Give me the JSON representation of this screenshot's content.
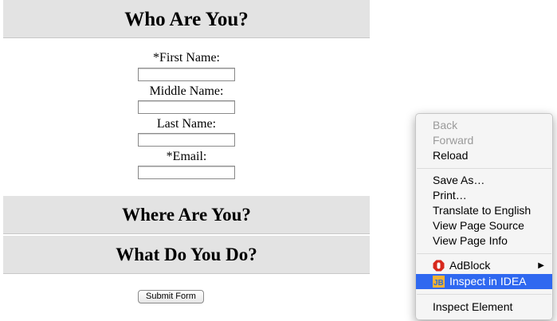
{
  "sections": {
    "who": "Who Are You?",
    "where": "Where Are You?",
    "what": "What Do You Do?"
  },
  "form": {
    "first_name_label": "*First Name:",
    "middle_name_label": "Middle Name:",
    "last_name_label": "Last Name:",
    "email_label": "*Email:",
    "first_name_value": "",
    "middle_name_value": "",
    "last_name_value": "",
    "email_value": "",
    "submit_label": "Submit Form"
  },
  "context_menu": {
    "back": "Back",
    "forward": "Forward",
    "reload": "Reload",
    "save_as": "Save As…",
    "print": "Print…",
    "translate": "Translate to English",
    "view_source": "View Page Source",
    "view_info": "View Page Info",
    "adblock": "AdBlock",
    "inspect_idea": "Inspect in IDEA",
    "inspect_element": "Inspect Element",
    "submenu_arrow": "▶",
    "highlight_color": "#2f68f0",
    "adblock_icon": "adblock-icon",
    "jetbrains_icon": "jetbrains-icon"
  }
}
